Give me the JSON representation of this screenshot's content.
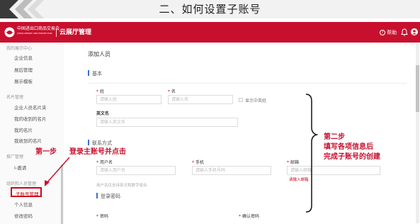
{
  "banner": {
    "title": "二、如何设置子账号"
  },
  "header": {
    "logo_text_line1": "中国进出口商品交易会",
    "logo_text_line2": "CHINA IMPORT AND EXPORT FAIR",
    "app_title": "云展厅管理",
    "help_label": "帮助"
  },
  "sidebar": {
    "groups": [
      {
        "label": "我的展示中心",
        "items": [
          "企业信息",
          "展后管理",
          "展示模板"
        ]
      },
      {
        "label": "名片管理",
        "items": [
          "企业人员名片夹",
          "我的收到的名片",
          "我的名片",
          "我收到的名片"
        ]
      },
      {
        "label": "推广管理",
        "items": [
          "I-邀请"
        ]
      },
      {
        "label": "组织和人员管理",
        "items": [
          "子账号管理",
          "个人信息",
          "修改密码"
        ]
      }
    ]
  },
  "main": {
    "page_title": "添加人员",
    "basic_section": "基本",
    "last_name_label": "姓",
    "last_name_placeholder": "请输入姓",
    "first_name_label": "名",
    "first_name_placeholder": "请输入名",
    "show_chinese_label": "显示中英姓",
    "english_name_label": "英文名",
    "english_name_placeholder": "请输入英文名",
    "contact_section": "联系方式",
    "username_label": "用户名",
    "username_placeholder": "请输入用户名",
    "phone_label": "手机",
    "phone_placeholder": "请输入手机号码",
    "email_label": "邮箱",
    "email_placeholder": "请输入邮箱",
    "username_hint": "用户名仅支持英文和数字组合",
    "email_hint": "请输入邮箱",
    "login_section": "登录密码",
    "password_label": "密码",
    "confirm_password_label": "确认密码"
  },
  "annotations": {
    "step1_label": "第一步",
    "step1_text": "登录主账号并点击",
    "step2_line1": "第二步",
    "step2_line2": "填写各项信息后",
    "step2_line3": "完成子账号的创建"
  },
  "colors": {
    "brand_red": "#c8102e",
    "annotation_red": "#c8102e",
    "accent_blue": "#3b6fd6"
  }
}
